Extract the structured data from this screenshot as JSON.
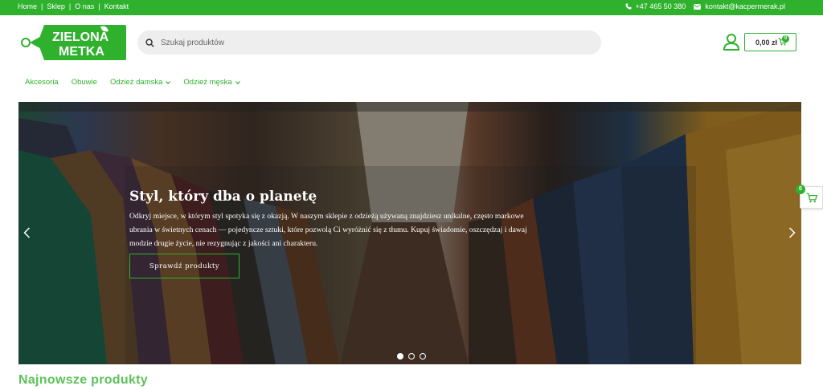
{
  "topbar": {
    "nav": [
      "Home",
      "Sklep",
      "O nas",
      "Kontakt"
    ],
    "separator": "|",
    "phone": "+47 465 50 380",
    "email": "kontakt@kacpermerak.pl",
    "phone_icon": "phone-icon",
    "email_icon": "envelope-icon"
  },
  "logo": {
    "line1": "ZIELONA",
    "line2": "METKA",
    "icon": "price-tag-leaf-logo"
  },
  "search": {
    "placeholder": "Szukaj produktów",
    "icon": "search-icon"
  },
  "header": {
    "user_icon": "user-icon",
    "cart_total": "0,00 zł",
    "cart_count": "0",
    "cart_icon": "cart-icon"
  },
  "menu": {
    "items": [
      {
        "label": "Akcesoria",
        "dropdown": false
      },
      {
        "label": "Obuwie",
        "dropdown": false
      },
      {
        "label": "Odzież damska",
        "dropdown": true
      },
      {
        "label": "Odzież męska",
        "dropdown": true
      }
    ]
  },
  "hero": {
    "headline": "Styl, który dba o planetę",
    "description": "Odkryj miejsce, w którym styl spotyka się z okazją. W naszym sklepie z odzieżą używaną znajdziesz unikalne, często markowe ubrania w świetnych cenach — pojedyncze sztuki, które pozwolą Ci wyróżnić się z tłumu. Kupuj świadomie, oszczędzaj i dawaj modzie drugie życie, nie rezygnując z jakości ani charakteru.",
    "cta": "Sprawdź produkty",
    "slides": 3,
    "active_slide": 1,
    "prev_icon": "chevron-left-icon",
    "next_icon": "chevron-right-icon"
  },
  "floating_cart": {
    "count": "0",
    "icon": "cart-icon"
  },
  "sections": {
    "newest_title": "Najnowsze produkty"
  },
  "colors": {
    "brand_green": "#2fb12e",
    "section_title_green": "#5dc25a",
    "search_bg": "#eeeeee"
  }
}
